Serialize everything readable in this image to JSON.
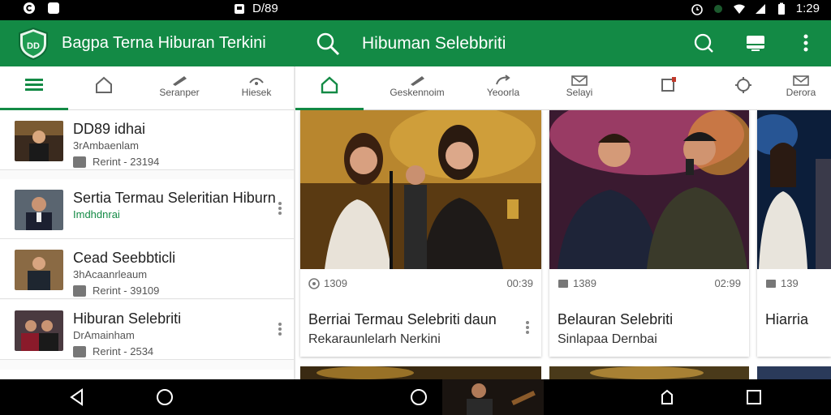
{
  "status_bar": {
    "left_icons": [
      "app-c-icon",
      "app-square-icon"
    ],
    "center_text": "D/89",
    "time": "1:29",
    "right_icons": [
      "alarm-icon",
      "vpn-icon",
      "wifi-icon",
      "signal-icon",
      "battery-icon"
    ]
  },
  "app_bar_left": {
    "title": "Bagpa Terna Hiburan Terkini",
    "logo": "shield-logo"
  },
  "app_bar_right": {
    "title": "Hibuman Selebbriti",
    "actions": [
      "search-icon",
      "notifications-icon",
      "cast-icon",
      "more-vert-icon"
    ]
  },
  "left_tabs": [
    {
      "label": "",
      "icon": "menu-icon",
      "active": true
    },
    {
      "label": "",
      "icon": "home-icon",
      "active": false
    },
    {
      "label": "Seranper",
      "icon": "edit-icon",
      "active": false
    },
    {
      "label": "Hiesek",
      "icon": "wifi-icon",
      "active": false
    }
  ],
  "right_tabs": [
    {
      "label": "",
      "icon": "home-icon",
      "active": true
    },
    {
      "label": "Geskennoim",
      "icon": "edit-icon",
      "active": false
    },
    {
      "label": "Yeoorla",
      "icon": "share-icon",
      "active": false
    },
    {
      "label": "Selayi",
      "icon": "mail-icon",
      "active": false
    },
    {
      "label": "",
      "icon": "flag-icon",
      "active": false
    },
    {
      "label": "",
      "icon": "settings-icon",
      "active": false
    },
    {
      "label": "Derora",
      "icon": "mail-icon",
      "active": false
    }
  ],
  "list_items": [
    {
      "title": "DD89  idhai",
      "subtitle": "3rAmbaenlam",
      "meta": "Rerint - 23194",
      "has_more": false
    },
    {
      "title": "Sertia Termau Seleritian Hiburn",
      "subtitle": "Imdhdnrai",
      "meta": "",
      "has_more": true
    },
    {
      "title": "Cead Seebbticli",
      "subtitle": "3hAcaanrleaum",
      "meta": "Rerint - 39109",
      "has_more": false
    },
    {
      "title": "Hiburan Selebriti",
      "subtitle": "DrAmainham",
      "meta": "Rerint - 2534",
      "has_more": true
    }
  ],
  "cards": [
    {
      "views": "1309",
      "duration": "00:39",
      "title": "Berriai Termau Selebriti daun",
      "subtitle": "Rekaraunlelarh Nerkini",
      "has_more": true
    },
    {
      "views": "1389",
      "duration": "02:99",
      "title": "Belauran Selebriti",
      "subtitle": "Sinlapaa  Dernbai",
      "has_more": false
    },
    {
      "views": "139",
      "duration": "",
      "title": "Hiarria",
      "subtitle": "",
      "has_more": false
    }
  ],
  "nav_bar": {
    "buttons": [
      "back-icon",
      "home-circle-icon",
      "home-circle-icon",
      "home-circle-icon",
      "recents-icon"
    ]
  },
  "colors": {
    "primary": "#138a45",
    "status_bar": "#000000",
    "nav_bar": "#000000",
    "background": "#ffffff",
    "text_primary": "#222222",
    "text_secondary": "#555555"
  }
}
